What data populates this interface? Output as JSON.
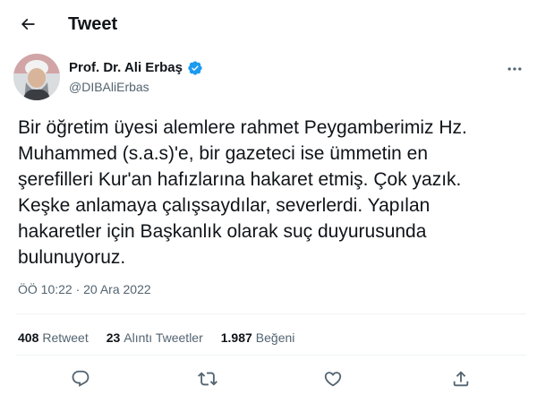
{
  "header": {
    "title": "Tweet"
  },
  "author": {
    "name": "Prof. Dr. Ali Erbaş",
    "handle": "@DIBAliErbas",
    "verified": true
  },
  "tweet": {
    "text": "Bir öğretim üyesi alemlere rahmet Peygamberimiz Hz.\nMuhammed (s.a.s)'e, bir gazeteci ise ümmetin en\nşerefilleri Kur'an hafızlarına hakaret etmiş. Çok yazık.\nKeşke anlamaya çalışsaydılar, severlerdi. Yapılan\nhakaretler için Başkanlık olarak suç duyurusunda\nbulunuyoruz.",
    "timestamp": "ÖÖ 10:22 · 20 Ara 2022"
  },
  "stats": [
    {
      "count": "408",
      "label": "Retweet"
    },
    {
      "count": "23",
      "label": "Alıntı Tweetler"
    },
    {
      "count": "1.987",
      "label": "Beğeni"
    }
  ],
  "actions": [
    "reply-icon",
    "retweet-icon",
    "like-icon",
    "share-icon"
  ],
  "colors": {
    "text": "#0f1419",
    "secondary": "#536471",
    "verified": "#1d9bf0",
    "divider": "#eff3f4"
  }
}
